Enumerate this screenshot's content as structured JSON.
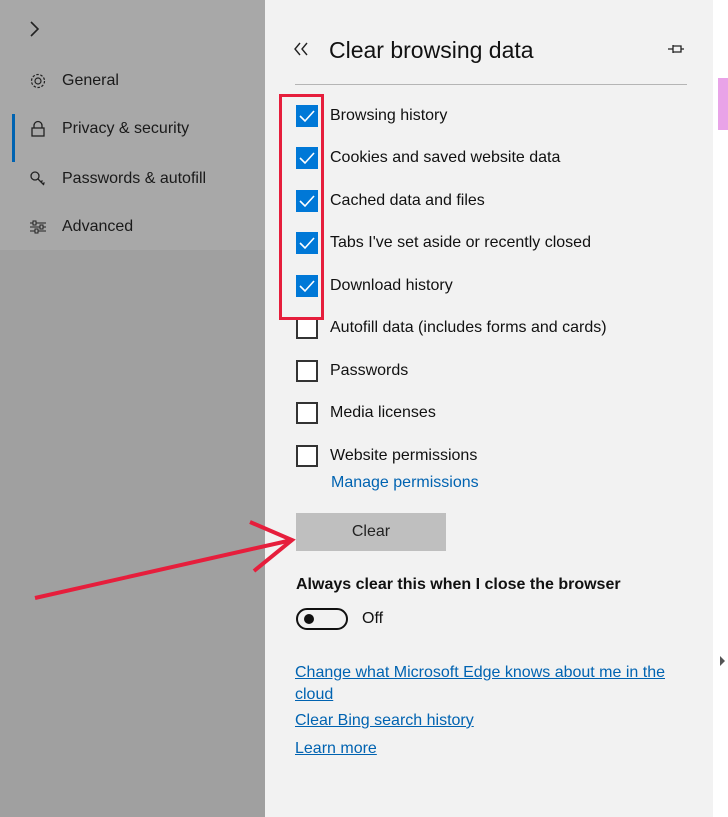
{
  "sidebar": {
    "expand_icon": "chevron-right",
    "items": [
      {
        "label": "General",
        "icon": "gear-icon"
      },
      {
        "label": "Privacy & security",
        "icon": "lock-icon"
      },
      {
        "label": "Passwords & autofill",
        "icon": "key-icon"
      },
      {
        "label": "Advanced",
        "icon": "sliders-icon"
      }
    ],
    "selected_index": 1
  },
  "panel": {
    "collapse_icon": "double-chevron-left",
    "title": "Clear browsing data",
    "pin_icon": "pin-icon",
    "options": [
      {
        "label": "Browsing history",
        "checked": true
      },
      {
        "label": "Cookies and saved website data",
        "checked": true
      },
      {
        "label": "Cached data and files",
        "checked": true
      },
      {
        "label": "Tabs I've set aside or recently closed",
        "checked": true
      },
      {
        "label": "Download history",
        "checked": true
      },
      {
        "label": "Autofill data (includes forms and cards)",
        "checked": false
      },
      {
        "label": "Passwords",
        "checked": false
      },
      {
        "label": "Media licenses",
        "checked": false
      },
      {
        "label": "Website permissions",
        "checked": false
      }
    ],
    "manage_permissions_link": "Manage permissions",
    "clear_button": "Clear",
    "always_clear_label": "Always clear this when I close the browser",
    "toggle_state": "Off",
    "links": [
      "Change what Microsoft Edge knows about me in the cloud",
      "Clear Bing search history",
      "Learn more"
    ]
  },
  "colors": {
    "accent": "#0078d7",
    "link": "#0063b1",
    "annotation": "#e61e3c"
  }
}
